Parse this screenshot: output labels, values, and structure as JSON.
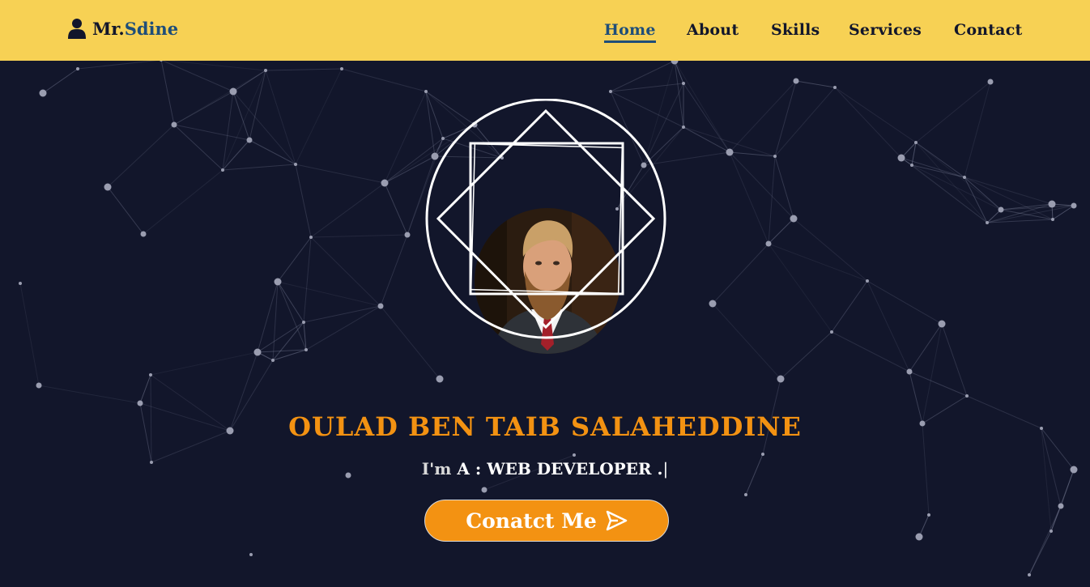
{
  "brand": {
    "name_part1": "Mr.",
    "name_part2": "Sdine",
    "icon": "user-icon"
  },
  "nav": {
    "items": [
      {
        "label": "Home",
        "active": true
      },
      {
        "label": "About",
        "active": false
      },
      {
        "label": "Skills",
        "active": false
      },
      {
        "label": "Services",
        "active": false
      },
      {
        "label": "Contact",
        "active": false
      }
    ]
  },
  "hero": {
    "name": "OULAD BEN TAIB SALAHEDDINE",
    "tagline_prefix": "I'm",
    "tagline_main": "A : WEB DEVELOPER .",
    "cursor": "|",
    "cta_label": "Conatct Me",
    "cta_icon": "send-icon",
    "avatar": "profile-photo"
  },
  "colors": {
    "navbar_bg": "#f7d154",
    "page_bg": "#12162b",
    "accent_orange": "#f39212",
    "link_active": "#1f4e79"
  }
}
